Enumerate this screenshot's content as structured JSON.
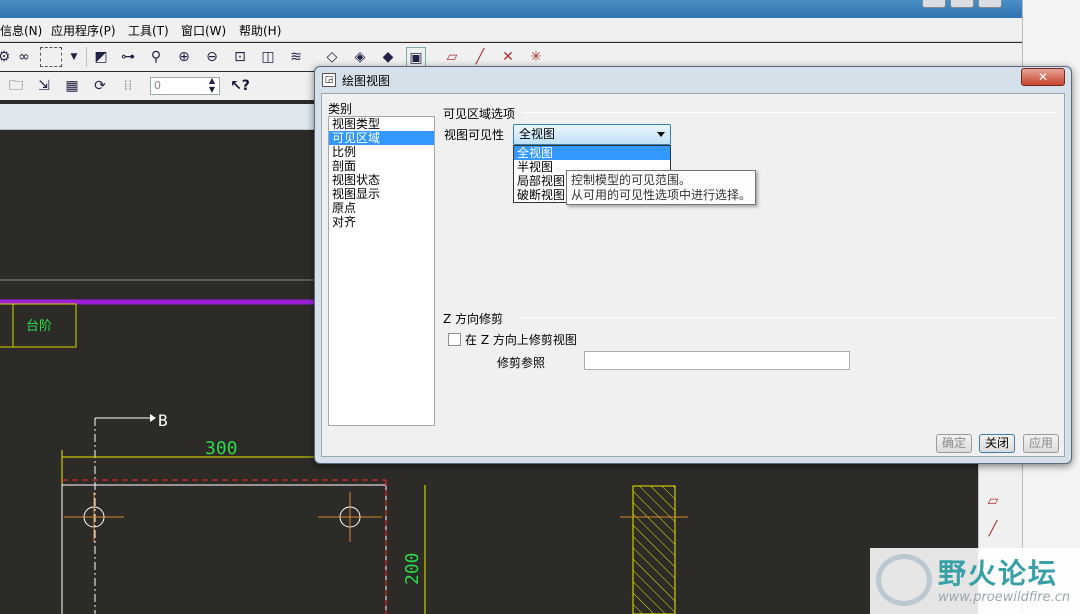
{
  "menubar": {
    "items": [
      "信息(N)",
      "应用程序(P)",
      "工具(T)",
      "窗口(W)",
      "帮助(H)"
    ]
  },
  "toolbar": {
    "spin_value": "0"
  },
  "drawing": {
    "dim_width": "300",
    "dim_height": "200",
    "section_label": "B",
    "tag_text": "台阶"
  },
  "dialog": {
    "title": "绘图视图",
    "close_glyph": "✕",
    "category_label": "类别",
    "categories": [
      "视图类型",
      "可见区域",
      "比例",
      "剖面",
      "视图状态",
      "视图显示",
      "原点",
      "对齐"
    ],
    "selected_category": "可见区域",
    "visible_area_group": "可见区域选项",
    "visibility_label": "视图可见性",
    "visibility_value": "全视图",
    "visibility_options": [
      "全视图",
      "半视图",
      "局部视图",
      "破断视图"
    ],
    "tooltip_line1": "控制模型的可见范围。",
    "tooltip_line2": "从可用的可见性选项中进行选择。",
    "z_trim_group": "Z 方向修剪",
    "z_trim_checkbox": "在 Z 方向上修剪视图",
    "z_trim_checked": false,
    "trim_ref_label": "修剪参照",
    "trim_ref_value": "",
    "buttons": {
      "ok": "确定",
      "close": "关闭",
      "apply": "应用"
    }
  },
  "watermark": {
    "text": "野火论坛",
    "url": "www.proewildfire.cn"
  }
}
